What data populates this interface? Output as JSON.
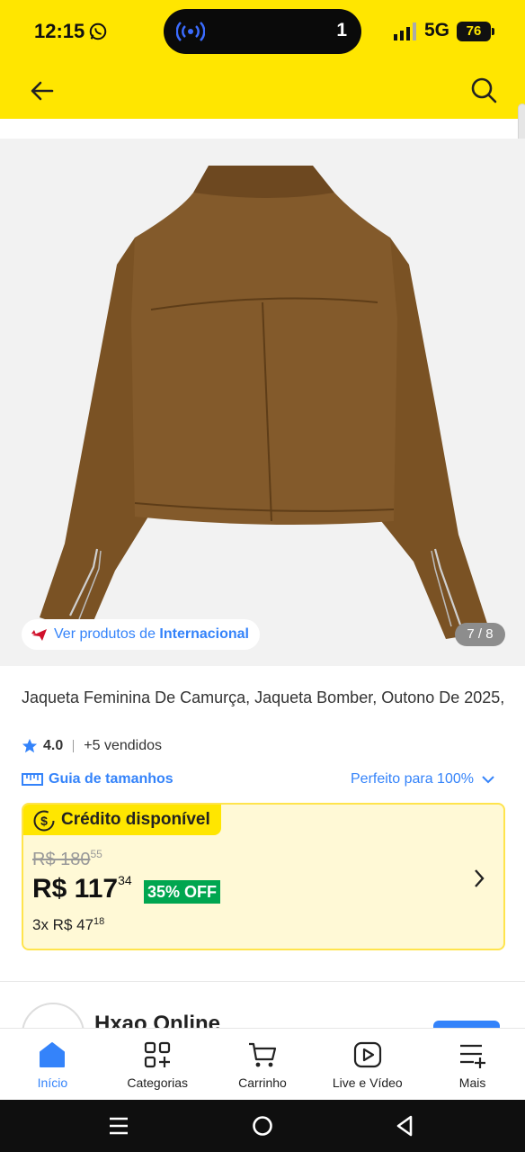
{
  "status_bar": {
    "time": "12:15",
    "notification_count": "1",
    "network": "5G",
    "battery": "76"
  },
  "app_bar": {
    "back_icon": "arrow-left-icon",
    "search_icon": "search-icon",
    "background_color": "#FFE600"
  },
  "gallery": {
    "image_subject": "brown suede jacket back view",
    "international_prefix": "Ver produtos de ",
    "international_brand": "Internacional",
    "counter": "7 / 8"
  },
  "product": {
    "title": "Jaqueta Feminina De Camurça, Jaqueta Bomber, Outono De 2025,",
    "rating": "4.0",
    "sold": "+5 vendidos",
    "size_guide": "Guia de tamanhos",
    "fit": "Perfeito para 100%"
  },
  "credit": {
    "tag": "Crédito disponível",
    "old_price_main": "R$ 180",
    "old_price_cents": "55",
    "price_main": "R$ 117",
    "price_cents": "34",
    "discount": "35% OFF",
    "installments_main": "3x R$ 47",
    "installments_cents": "18"
  },
  "seller": {
    "name": "Hxao Online"
  },
  "tabs": [
    {
      "label": "Início",
      "icon": "home-icon",
      "active": true
    },
    {
      "label": "Categorias",
      "icon": "categories-icon",
      "active": false
    },
    {
      "label": "Carrinho",
      "icon": "cart-icon",
      "active": false
    },
    {
      "label": "Live e Vídeo",
      "icon": "play-icon",
      "active": false
    },
    {
      "label": "Mais",
      "icon": "more-icon",
      "active": false
    }
  ],
  "colors": {
    "brand_yellow": "#FFE600",
    "link_blue": "#3483FA",
    "discount_green": "#00A650"
  }
}
